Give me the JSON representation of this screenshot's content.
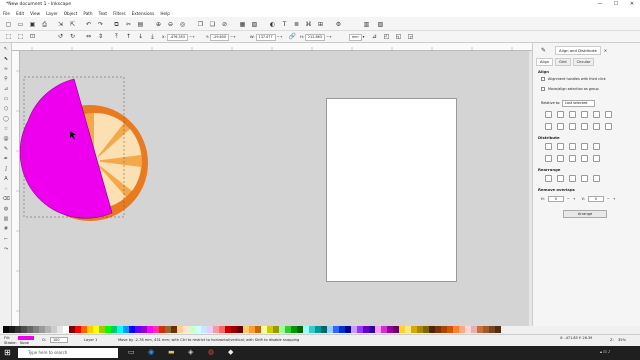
{
  "window": {
    "title": "*New document 1 - Inkscape",
    "controls": [
      "—",
      "☐",
      "✕"
    ]
  },
  "menu": [
    "File",
    "Edit",
    "View",
    "Layer",
    "Object",
    "Path",
    "Text",
    "Filters",
    "Extensions",
    "Help"
  ],
  "controls": {
    "x_label": "X:",
    "x_value": "-476.553",
    "y_label": "Y:",
    "y_value": "-29.650",
    "w_label": "W:",
    "w_value": "137.077",
    "h_label": "H:",
    "h_value": "212.863",
    "unit": "mm"
  },
  "dock": {
    "panel_title": "Align and Distribute",
    "subtabs": [
      "Align",
      "Grid",
      "Circular"
    ],
    "align_heading": "Align",
    "opt1": "Alignment handles with third click",
    "opt2": "Move/align selection as group",
    "relative_label": "Relative to:",
    "relative_value": "Last selected",
    "distribute_heading": "Distribute",
    "rearrange_heading": "Rearrange",
    "remove_overlaps_heading": "Remove overlaps",
    "h_gap_label": "H:",
    "h_gap_value": "0",
    "v_gap_label": "V:",
    "v_gap_value": "0",
    "arrange_button": "Arrange"
  },
  "status": {
    "fill_label": "Fill:",
    "stroke_label": "Stroke:",
    "stroke_value": "None",
    "opacity_label": "O:",
    "opacity_value": "100",
    "layer": "Layer 1",
    "message": "Move by -2.78 mm, 431 mm; with Ctrl to restrict to horizontal/vertical; with Shift to disable snapping",
    "zoom_label": "Z:",
    "zoom_value": "35%",
    "coords": "X: -471.83  Y: 26.39"
  },
  "taskbar": {
    "search_placeholder": "Type here to search"
  },
  "colors": {
    "magenta": "#ee00ee",
    "orange": "#e87a1f",
    "orange_light": "#f5a84a",
    "cream": "#fbe0b4"
  },
  "palette": [
    "#000000",
    "#1a1a1a",
    "#333333",
    "#4d4d4d",
    "#666666",
    "#808080",
    "#999999",
    "#b3b3b3",
    "#cccccc",
    "#e6e6e6",
    "#ffffff",
    "#800000",
    "#ff0000",
    "#ff6600",
    "#ffcc00",
    "#ffff00",
    "#99cc00",
    "#00ff00",
    "#00cc66",
    "#00ffff",
    "#0099ff",
    "#0000ff",
    "#6600ff",
    "#9900cc",
    "#ff00ff",
    "#ff3399",
    "#cc3300",
    "#996633",
    "#663300",
    "#ffcc99",
    "#ffe6cc",
    "#ccffcc",
    "#ccffff",
    "#cce6ff",
    "#e6ccff",
    "#ff9999",
    "#ff6666",
    "#cc0000",
    "#990000",
    "#660000",
    "#ffcc66",
    "#ff9933",
    "#cc6600",
    "#ffff99",
    "#cccc00",
    "#999900",
    "#99ff99",
    "#33cc33",
    "#009900",
    "#006600",
    "#99ffff",
    "#33cccc",
    "#009999",
    "#006666",
    "#99ccff",
    "#3366ff",
    "#0033cc",
    "#000099",
    "#cc99ff",
    "#9933ff",
    "#6600cc",
    "#330099",
    "#ff99ff",
    "#cc33cc",
    "#990099",
    "#660066",
    "#ffd42a",
    "#ffe680",
    "#d4aa00",
    "#aa8800",
    "#806600",
    "#552200",
    "#803300",
    "#aa4400",
    "#d45500",
    "#ff7f2a",
    "#ffaa80",
    "#ffd5d5",
    "#e9afaf",
    "#c87137",
    "#a05a2c",
    "#784421",
    "#502d16"
  ]
}
